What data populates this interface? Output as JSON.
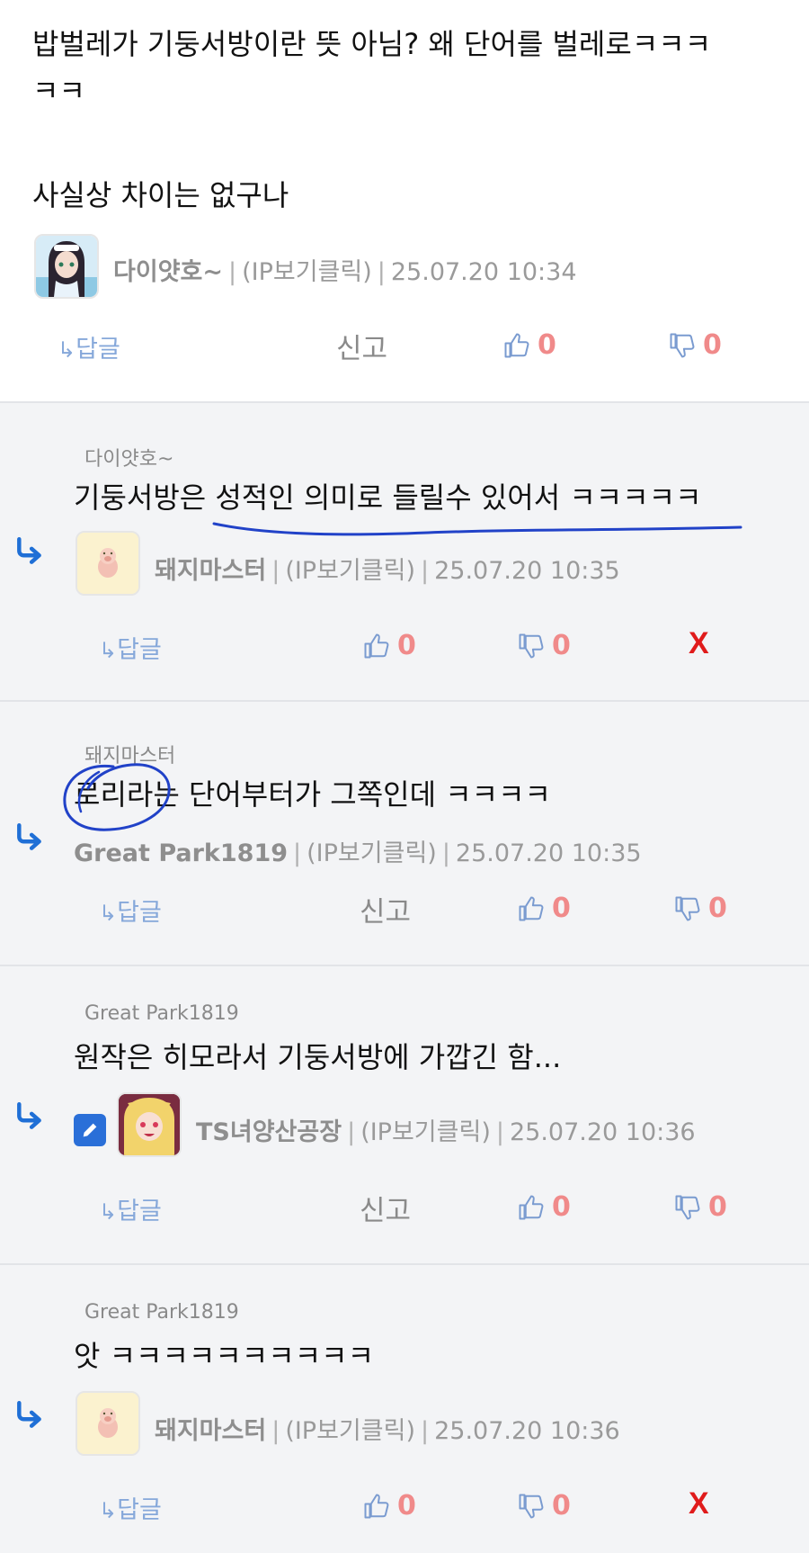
{
  "labels": {
    "reply": "답글",
    "report": "신고",
    "delete": "X",
    "meta_ip": "(IP보기클릭)",
    "sep": "|"
  },
  "comments": [
    {
      "parent": "",
      "body_lines": [
        "밥벌레가 기둥서방이란 뜻 아님? 왜 단어를 벌레로ㅋㅋㅋ",
        "ㅋㅋ",
        "사실상 차이는 없구나"
      ],
      "author": "다이얏호~",
      "date": "25.07.20 10:34",
      "likes": "0",
      "dislikes": "0"
    },
    {
      "parent": "다이얏호~",
      "body_lines": [
        "기둥서방은 성적인 의미로 들릴수 있어서 ㅋㅋㅋㅋㅋ"
      ],
      "author": "돼지마스터",
      "date": "25.07.20 10:35",
      "likes": "0",
      "dislikes": "0"
    },
    {
      "parent": "돼지마스터",
      "body_lines": [
        "로리라는 단어부터가 그쪽인데 ㅋㅋㅋㅋ"
      ],
      "author": "Great Park1819",
      "date": "25.07.20 10:35",
      "likes": "0",
      "dislikes": "0"
    },
    {
      "parent": "Great Park1819",
      "body_lines": [
        "원작은 히모라서 기둥서방에 가깝긴 함..."
      ],
      "author": "TS녀양산공장",
      "date": "25.07.20 10:36",
      "likes": "0",
      "dislikes": "0"
    },
    {
      "parent": "Great Park1819",
      "body_lines": [
        "앗 ㅋㅋㅋㅋㅋㅋㅋㅋㅋㅋ"
      ],
      "author": "돼지마스터",
      "date": "25.07.20 10:36",
      "likes": "0",
      "dislikes": "0"
    }
  ]
}
